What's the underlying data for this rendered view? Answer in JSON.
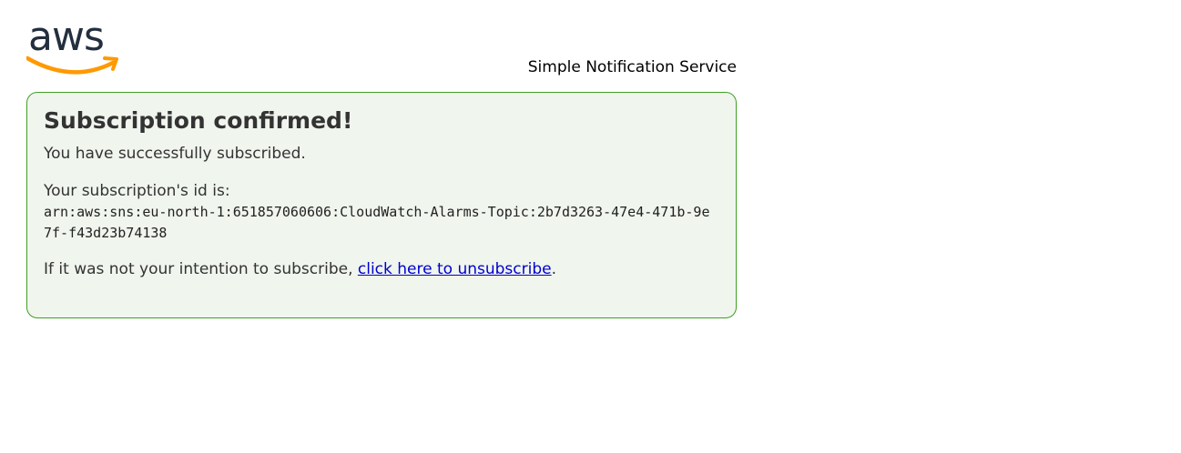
{
  "header": {
    "logo_text": "aws",
    "service_name": "Simple Notification Service"
  },
  "confirmation": {
    "title": "Subscription confirmed!",
    "success_message": "You have successfully subscribed.",
    "id_label": "Your subscription's id is:",
    "subscription_arn": "arn:aws:sns:eu-north-1:651857060606:CloudWatch-Alarms-Topic:2b7d3263-47e4-471b-9e7f-f43d23b74138",
    "unsubscribe_prefix": "If it was not your intention to subscribe, ",
    "unsubscribe_link": "click here to unsubscribe",
    "unsubscribe_suffix": "."
  },
  "colors": {
    "logo_text": "#232f3e",
    "logo_smile": "#ff9900",
    "box_border": "#3f9f22",
    "box_background": "#f0f5ee",
    "link": "#0000cc"
  }
}
